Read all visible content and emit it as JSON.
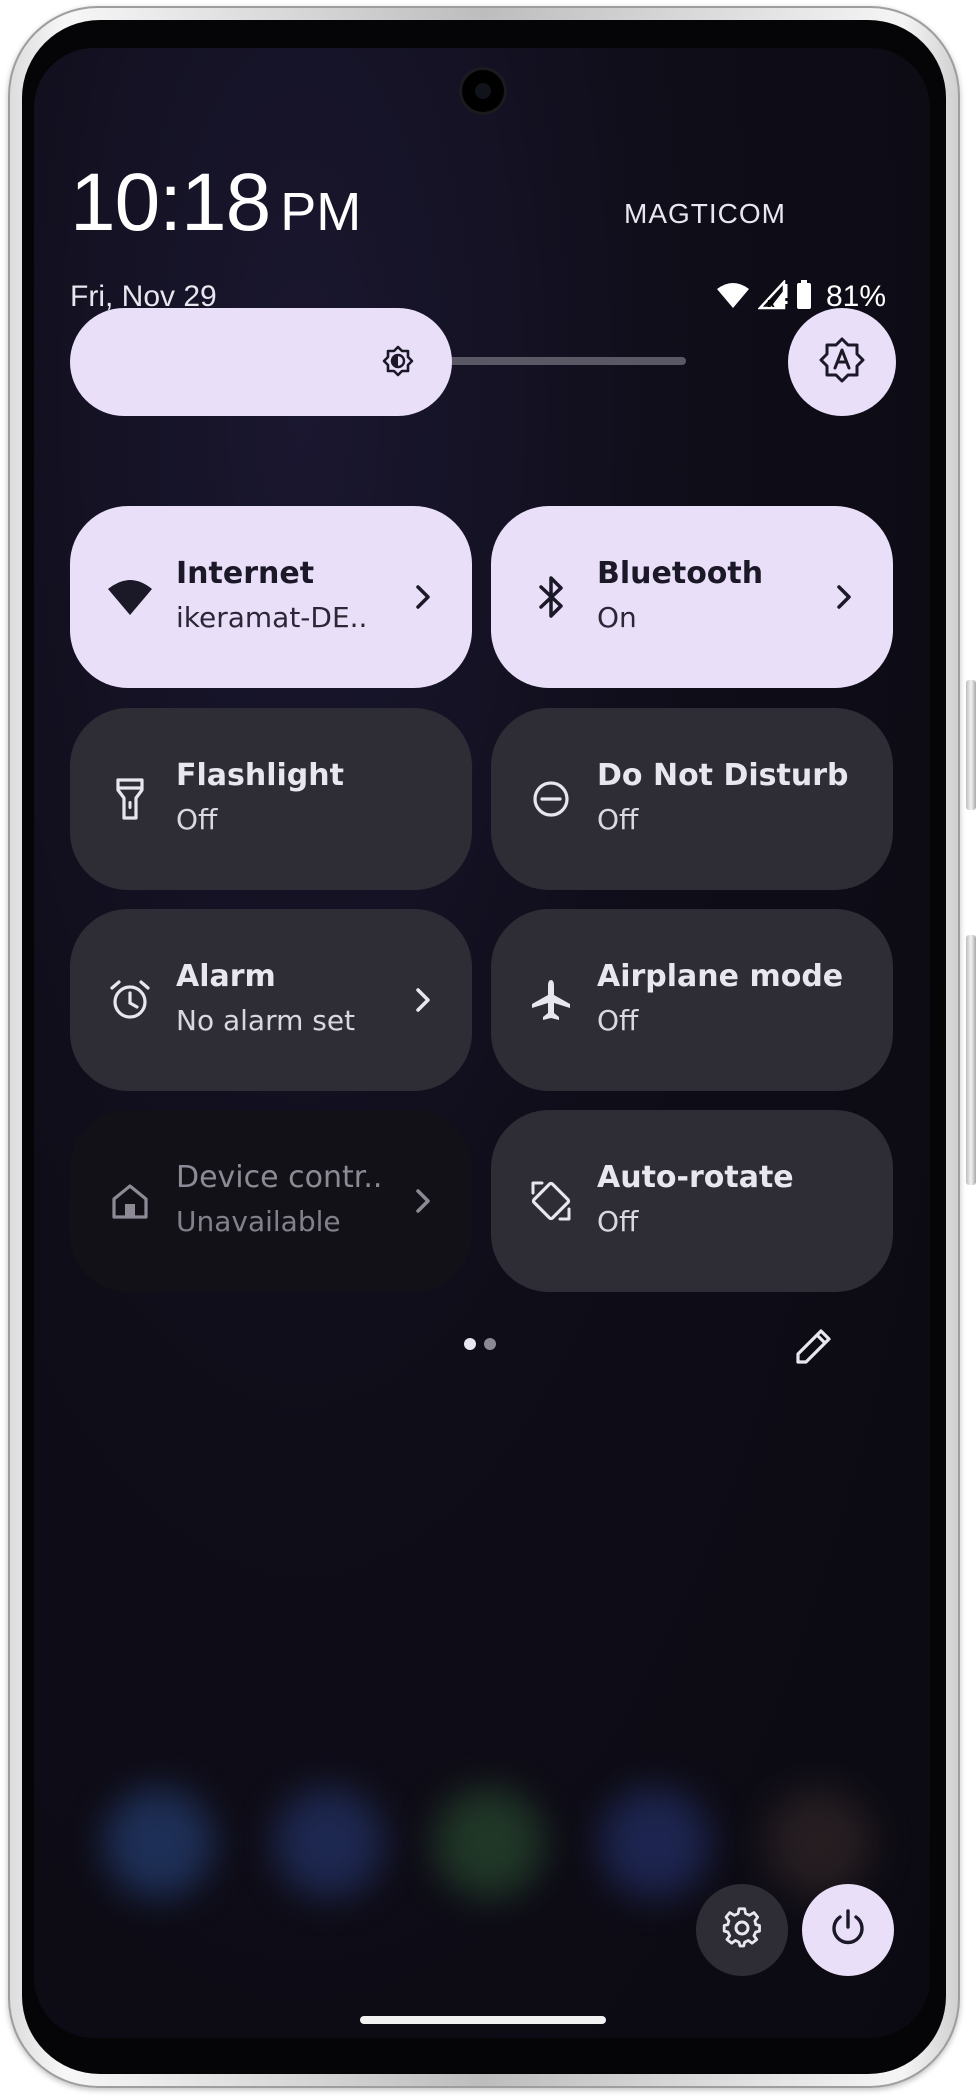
{
  "status": {
    "time": "10:18",
    "ampm": "PM",
    "carrier": "MAGTICOM",
    "date": "Fri, Nov 29",
    "battery": "81%"
  },
  "brightness": {
    "level_fraction": 0.62
  },
  "tiles": [
    {
      "label": "Internet",
      "sub": "ikeramat-DE..",
      "state": "on",
      "icon": "wifi-icon",
      "chevron": true
    },
    {
      "label": "Bluetooth",
      "sub": "On",
      "state": "on",
      "icon": "bluetooth-icon",
      "chevron": true
    },
    {
      "label": "Flashlight",
      "sub": "Off",
      "state": "off",
      "icon": "flashlight-icon",
      "chevron": false
    },
    {
      "label": "Do Not Disturb",
      "sub": "Off",
      "state": "off",
      "icon": "do-not-disturb-icon",
      "chevron": false
    },
    {
      "label": "Alarm",
      "sub": "No alarm set",
      "state": "off",
      "icon": "alarm-icon",
      "chevron": true
    },
    {
      "label": "Airplane mode",
      "sub": "Off",
      "state": "off",
      "icon": "airplane-icon",
      "chevron": false
    },
    {
      "label": "Device contr..",
      "sub": "Unavailable",
      "state": "unavailable",
      "icon": "home-icon",
      "chevron": true
    },
    {
      "label": "Auto-rotate",
      "sub": "Off",
      "state": "off",
      "icon": "auto-rotate-icon",
      "chevron": false
    }
  ],
  "pages": {
    "count": 2,
    "current": 1
  },
  "colors": {
    "tile_on": "#e9dff8",
    "tile_off": "#2e2c34",
    "tile_unavailable": "#121117",
    "background": "#0f0d18"
  }
}
